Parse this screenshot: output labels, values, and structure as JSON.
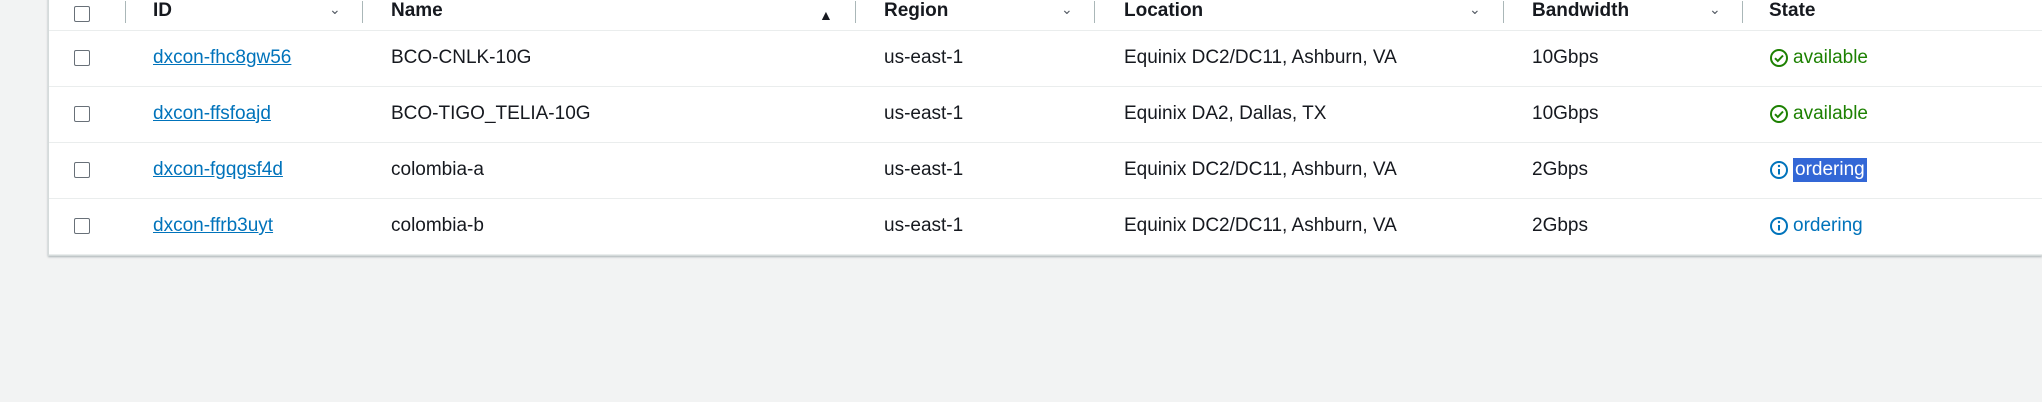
{
  "table": {
    "columns": {
      "id": "ID",
      "name": "Name",
      "region": "Region",
      "location": "Location",
      "bandwidth": "Bandwidth",
      "state": "State"
    },
    "rows": [
      {
        "id": "dxcon-fhc8gw56",
        "name": "BCO-CNLK-10G",
        "region": "us-east-1",
        "location": "Equinix DC2/DC11, Ashburn, VA",
        "bandwidth": "10Gbps",
        "state": "available",
        "state_kind": "success"
      },
      {
        "id": "dxcon-ffsfoajd",
        "name": "BCO-TIGO_TELIA-10G",
        "region": "us-east-1",
        "location": "Equinix DA2, Dallas, TX",
        "bandwidth": "10Gbps",
        "state": "available",
        "state_kind": "success"
      },
      {
        "id": "dxcon-fgqgsf4d",
        "name": "colombia-a",
        "region": "us-east-1",
        "location": "Equinix DC2/DC11, Ashburn, VA",
        "bandwidth": "2Gbps",
        "state": "ordering",
        "state_kind": "info",
        "selected_text": true
      },
      {
        "id": "dxcon-ffrb3uyt",
        "name": "colombia-b",
        "region": "us-east-1",
        "location": "Equinix DC2/DC11, Ashburn, VA",
        "bandwidth": "2Gbps",
        "state": "ordering",
        "state_kind": "info"
      }
    ]
  },
  "icons": {
    "sort": "chevron-down-icon",
    "sort_active": "sort-ascending-icon",
    "success": "check-circle-icon",
    "info": "info-circle-icon"
  },
  "colors": {
    "link": "#0073bb",
    "success": "#1d8102",
    "info": "#0073bb",
    "selection": "#3367d6"
  }
}
